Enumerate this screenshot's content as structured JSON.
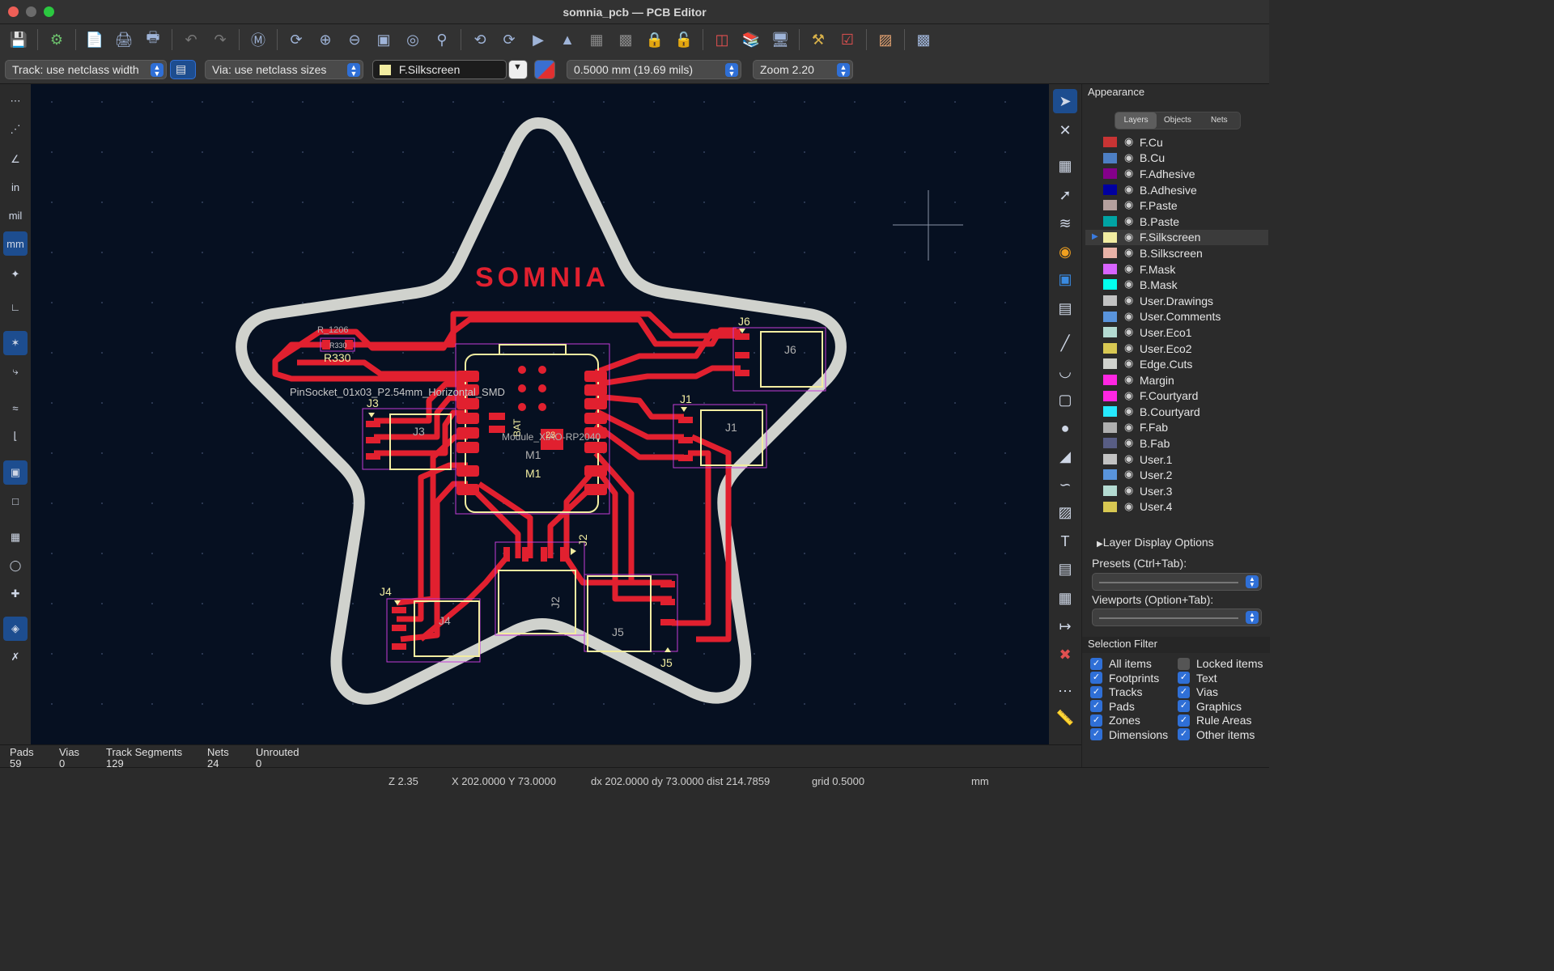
{
  "window": {
    "title": "somnia_pcb — PCB Editor"
  },
  "toolbar": {
    "icons": [
      "save-icon",
      "board-setup-icon",
      "page-settings-icon",
      "print-icon",
      "plot-icon",
      "undo-icon",
      "redo-icon",
      "find-icon",
      "redraw-icon",
      "zoom-in-icon",
      "zoom-out-icon",
      "zoom-fit-icon",
      "zoom-objects-icon",
      "zoom-selection-icon",
      "rotate-ccw-icon",
      "rotate-cw-icon",
      "flip-icon",
      "mirror-icon",
      "group-icon",
      "ungroup-icon",
      "lock-icon",
      "unlock-icon",
      "update-pcb-icon",
      "footprint-editor-icon",
      "footprint-library-icon",
      "scripting-icon",
      "drc-icon",
      "board-stats-icon",
      "console-icon"
    ]
  },
  "options": {
    "track_width": "Track: use netclass width",
    "via_size": "Via: use netclass sizes",
    "active_layer": "F.Silkscreen",
    "grid": "0.5000 mm (19.69 mils)",
    "zoom": "Zoom 2.20"
  },
  "board": {
    "brand_text": "SOMNIA",
    "labels": {
      "r330a": "R330",
      "r330b": "R330",
      "r1206": "R_1206",
      "pinsocket": "PinSocket_01x03_P2.54mm_Horizontal_SMD",
      "j1": "J1",
      "j1b": "J1",
      "j2": "J2",
      "j2b": "J2",
      "j3": "J3",
      "j3b": "J3",
      "j4": "J4",
      "j4b": "J4",
      "j5": "J5",
      "j5b": "J5",
      "j6": "J6",
      "j6b": "J6",
      "m1a": "M1",
      "m1b": "M1",
      "bat": "BAT",
      "module": "Module_XIAO-RP2040",
      "pad23": "23"
    }
  },
  "appearance": {
    "title": "Appearance",
    "tabs": [
      "Layers",
      "Objects",
      "Nets"
    ],
    "active_tab": "Layers",
    "layers": [
      {
        "name": "F.Cu",
        "color": "#c83434"
      },
      {
        "name": "B.Cu",
        "color": "#4d7fc4"
      },
      {
        "name": "F.Adhesive",
        "color": "#84008a"
      },
      {
        "name": "B.Adhesive",
        "color": "#0000a0"
      },
      {
        "name": "F.Paste",
        "color": "#b4a09e"
      },
      {
        "name": "B.Paste",
        "color": "#00a4a4"
      },
      {
        "name": "F.Silkscreen",
        "color": "#f2eda1"
      },
      {
        "name": "B.Silkscreen",
        "color": "#e8b2a7"
      },
      {
        "name": "F.Mask",
        "color": "#d864ff"
      },
      {
        "name": "B.Mask",
        "color": "#02ffee"
      },
      {
        "name": "User.Drawings",
        "color": "#c2c2c2"
      },
      {
        "name": "User.Comments",
        "color": "#5994dc"
      },
      {
        "name": "User.Eco1",
        "color": "#b4dbd2"
      },
      {
        "name": "User.Eco2",
        "color": "#d8c852"
      },
      {
        "name": "Edge.Cuts",
        "color": "#d0d2cd"
      },
      {
        "name": "Margin",
        "color": "#ff26e2"
      },
      {
        "name": "F.Courtyard",
        "color": "#ff26e2"
      },
      {
        "name": "B.Courtyard",
        "color": "#26e9ff"
      },
      {
        "name": "F.Fab",
        "color": "#afafaf"
      },
      {
        "name": "B.Fab",
        "color": "#585d84"
      },
      {
        "name": "User.1",
        "color": "#c2c2c2"
      },
      {
        "name": "User.2",
        "color": "#5994dc"
      },
      {
        "name": "User.3",
        "color": "#b4dbd2"
      },
      {
        "name": "User.4",
        "color": "#d8c852"
      }
    ],
    "selected_layer": "F.Silkscreen",
    "layer_display_options": "Layer Display Options",
    "presets_label": "Presets (Ctrl+Tab):",
    "viewports_label": "Viewports (Option+Tab):"
  },
  "selection_filter": {
    "title": "Selection Filter",
    "items": [
      {
        "label": "All items",
        "checked": true
      },
      {
        "label": "Locked items",
        "checked": false
      },
      {
        "label": "Footprints",
        "checked": true
      },
      {
        "label": "Text",
        "checked": true
      },
      {
        "label": "Tracks",
        "checked": true
      },
      {
        "label": "Vias",
        "checked": true
      },
      {
        "label": "Pads",
        "checked": true
      },
      {
        "label": "Graphics",
        "checked": true
      },
      {
        "label": "Zones",
        "checked": true
      },
      {
        "label": "Rule Areas",
        "checked": true
      },
      {
        "label": "Dimensions",
        "checked": true
      },
      {
        "label": "Other items",
        "checked": true
      }
    ]
  },
  "messages": {
    "pads_label": "Pads",
    "pads_value": "59",
    "vias_label": "Vias",
    "vias_value": "0",
    "tracks_label": "Track Segments",
    "tracks_value": "129",
    "nets_label": "Nets",
    "nets_value": "24",
    "unrouted_label": "Unrouted",
    "unrouted_value": "0"
  },
  "status": {
    "z": "Z 2.35",
    "xy": "X 202.0000  Y 73.0000",
    "delta": "dx 202.0000  dy 73.0000  dist 214.7859",
    "grid": "grid 0.5000",
    "units": "mm"
  },
  "colors": {
    "accent": "#2f6fd6",
    "copper": "#e1202f",
    "board_bg": "#061021",
    "edge": "#d0d2cd",
    "courtyard": "#c33bd6"
  }
}
